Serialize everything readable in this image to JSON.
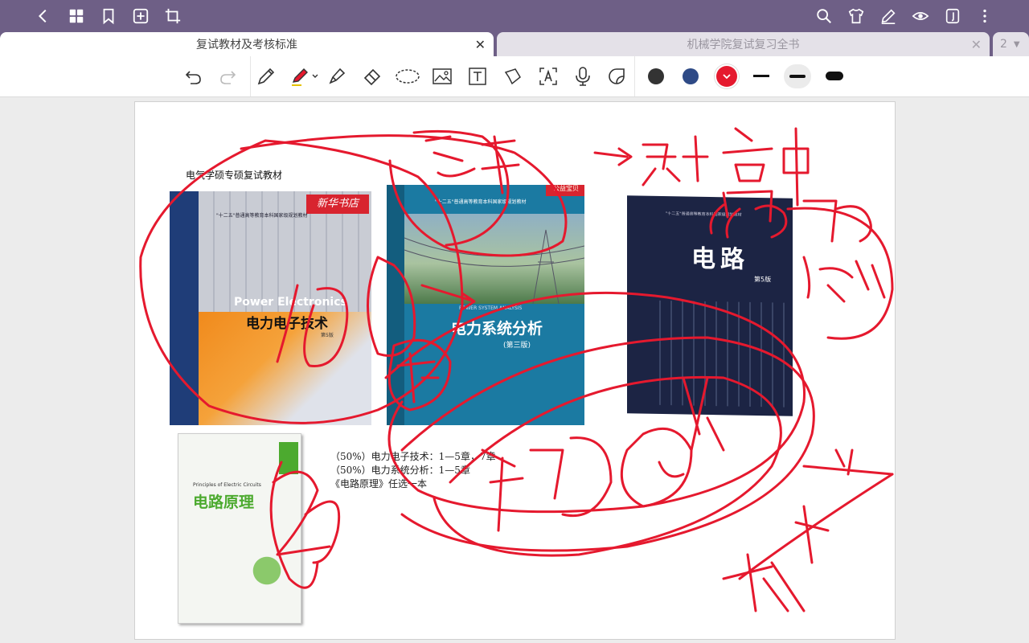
{
  "tabs": [
    {
      "label": "复试教材及考核标准"
    },
    {
      "label": "机械学院复试复习全书"
    }
  ],
  "tab_overflow": {
    "count": "2",
    "menu_icon": "caret-down-icon"
  },
  "colors": {
    "topbar": "#6e5f86",
    "pen_red": "#e5192e",
    "swatch_black": "#333333",
    "swatch_blue": "#2e4a86",
    "swatch_red": "#e5192e"
  },
  "document": {
    "heading": "电气学硕专硕复试教材",
    "books": [
      {
        "title": "电力电子技术",
        "edition": "第5版",
        "badge": "新华书店",
        "en": "Power Electronics",
        "series": "\"十二五\"普通高等教育本科国家级规划教材"
      },
      {
        "title": "电力系统分析",
        "edition": "(第三版)",
        "badge": "公益宝贝",
        "en": "POWER SYSTEM ANALYSIS",
        "series": "\"十二五\"普通高等教育本科国家级规划教材"
      },
      {
        "title": "电路",
        "edition": "第5版",
        "series": "\"十二五\"普通高等教育本科国家级规划教材"
      },
      {
        "title": "电路原理",
        "en": "Principles of Electric Circuits"
      }
    ],
    "info_lines": [
      "（50%）电力电子技术：1—5章，7章",
      "（50%）电力系统分析：1—5章",
      "《电路原理》任选一本"
    ]
  }
}
